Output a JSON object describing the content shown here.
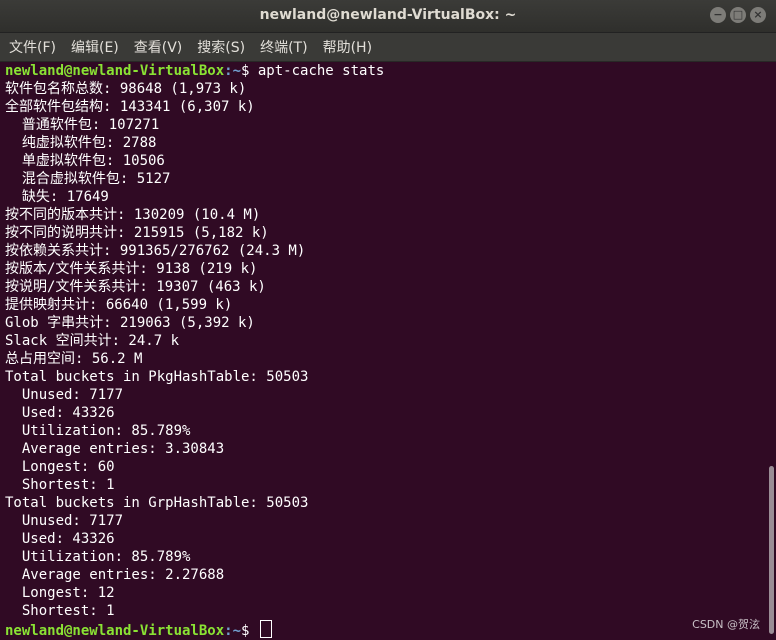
{
  "window": {
    "title": "newland@newland-VirtualBox: ~"
  },
  "window_controls": [
    "−",
    "□",
    "×"
  ],
  "menu": [
    "文件(F)",
    "编辑(E)",
    "查看(V)",
    "搜索(S)",
    "终端(T)",
    "帮助(H)"
  ],
  "prompt": {
    "user_host": "newland@newland-VirtualBox",
    "path": ":~",
    "symbol": "$ "
  },
  "command": "apt-cache stats",
  "output": [
    "软件包名称总数: 98648 (1,973 k)",
    "全部软件包结构: 143341 (6,307 k)",
    "  普通软件包: 107271",
    "  纯虚拟软件包: 2788",
    "  单虚拟软件包: 10506",
    "  混合虚拟软件包: 5127",
    "  缺失: 17649",
    "按不同的版本共计: 130209 (10.4 M)",
    "按不同的说明共计: 215915 (5,182 k)",
    "按依赖关系共计: 991365/276762 (24.3 M)",
    "按版本/文件关系共计: 9138 (219 k)",
    "按说明/文件关系共计: 19307 (463 k)",
    "提供映射共计: 66640 (1,599 k)",
    "Glob 字串共计: 219063 (5,392 k)",
    "Slack 空间共计: 24.7 k",
    "总占用空间: 56.2 M",
    "Total buckets in PkgHashTable: 50503",
    "  Unused: 7177",
    "  Used: 43326",
    "  Utilization: 85.789%",
    "  Average entries: 3.30843",
    "  Longest: 60",
    "  Shortest: 1",
    "Total buckets in GrpHashTable: 50503",
    "  Unused: 7177",
    "  Used: 43326",
    "  Utilization: 85.789%",
    "  Average entries: 2.27688",
    "  Longest: 12",
    "  Shortest: 1"
  ],
  "watermark": "CSDN @贺泫"
}
